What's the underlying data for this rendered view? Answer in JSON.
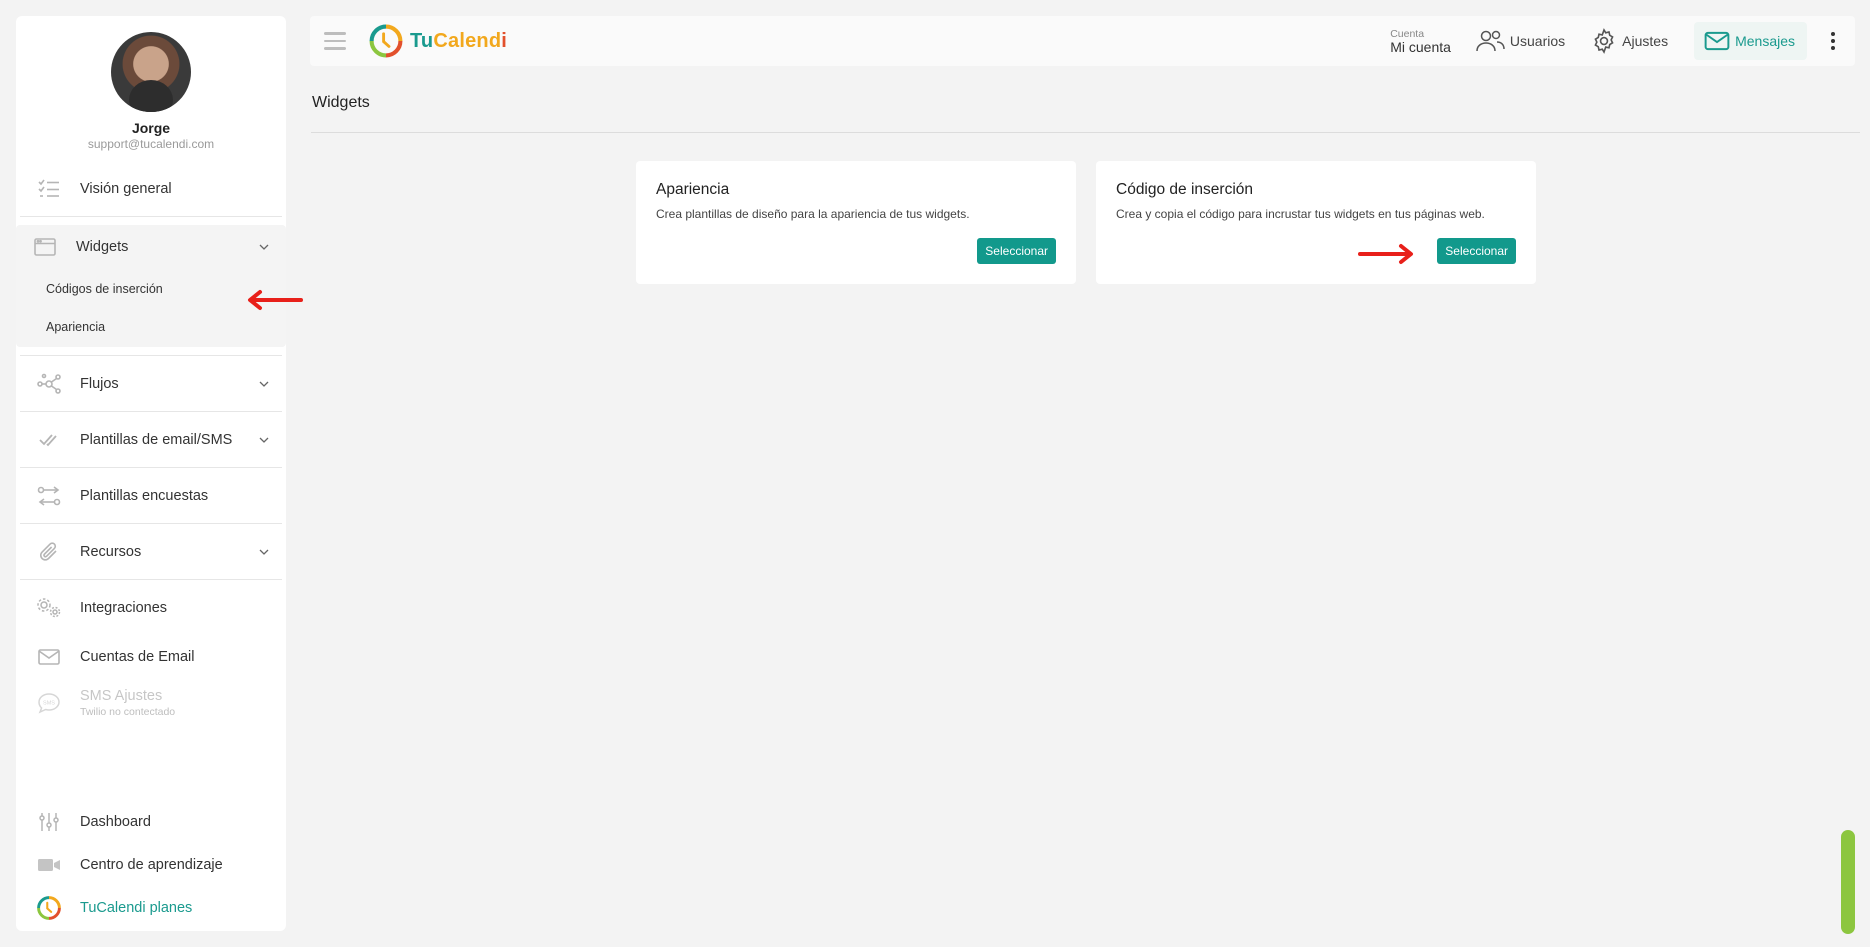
{
  "profile": {
    "name": "Jorge",
    "email": "support@tucalendi.com"
  },
  "sidebar": {
    "overview": "Visión general",
    "widgets": {
      "label": "Widgets",
      "items": [
        "Códigos de inserción",
        "Apariencia"
      ]
    },
    "flujos": "Flujos",
    "email_templates": "Plantillas de email/SMS",
    "survey_templates": "Plantillas encuestas",
    "resources": "Recursos",
    "integrations": "Integraciones",
    "email_accounts": "Cuentas de Email",
    "sms": {
      "label": "SMS Ajustes",
      "status": "Twilio no contectado"
    },
    "dashboard": "Dashboard",
    "learning": "Centro de aprendizaje",
    "plans": "TuCalendi planes"
  },
  "topbar": {
    "logo": {
      "part1": "Tu",
      "part2": "Calend",
      "part3": "i"
    },
    "account_small": "Cuenta",
    "account_big": "Mi cuenta",
    "users": "Usuarios",
    "settings": "Ajustes",
    "messages": "Mensajes"
  },
  "main": {
    "title": "Widgets",
    "cards": [
      {
        "title": "Apariencia",
        "description": "Crea plantillas de diseño para la apariencia de tus widgets.",
        "button": "Seleccionar"
      },
      {
        "title": "Código de inserción",
        "description": "Crea y copia el código para incrustar tus widgets en tus páginas web.",
        "button": "Seleccionar"
      }
    ]
  },
  "colors": {
    "brand_teal": "#12998c",
    "brand_orange": "#f2a81d",
    "annotation_red": "#e8201a",
    "scroll_green": "#8cc63f"
  }
}
